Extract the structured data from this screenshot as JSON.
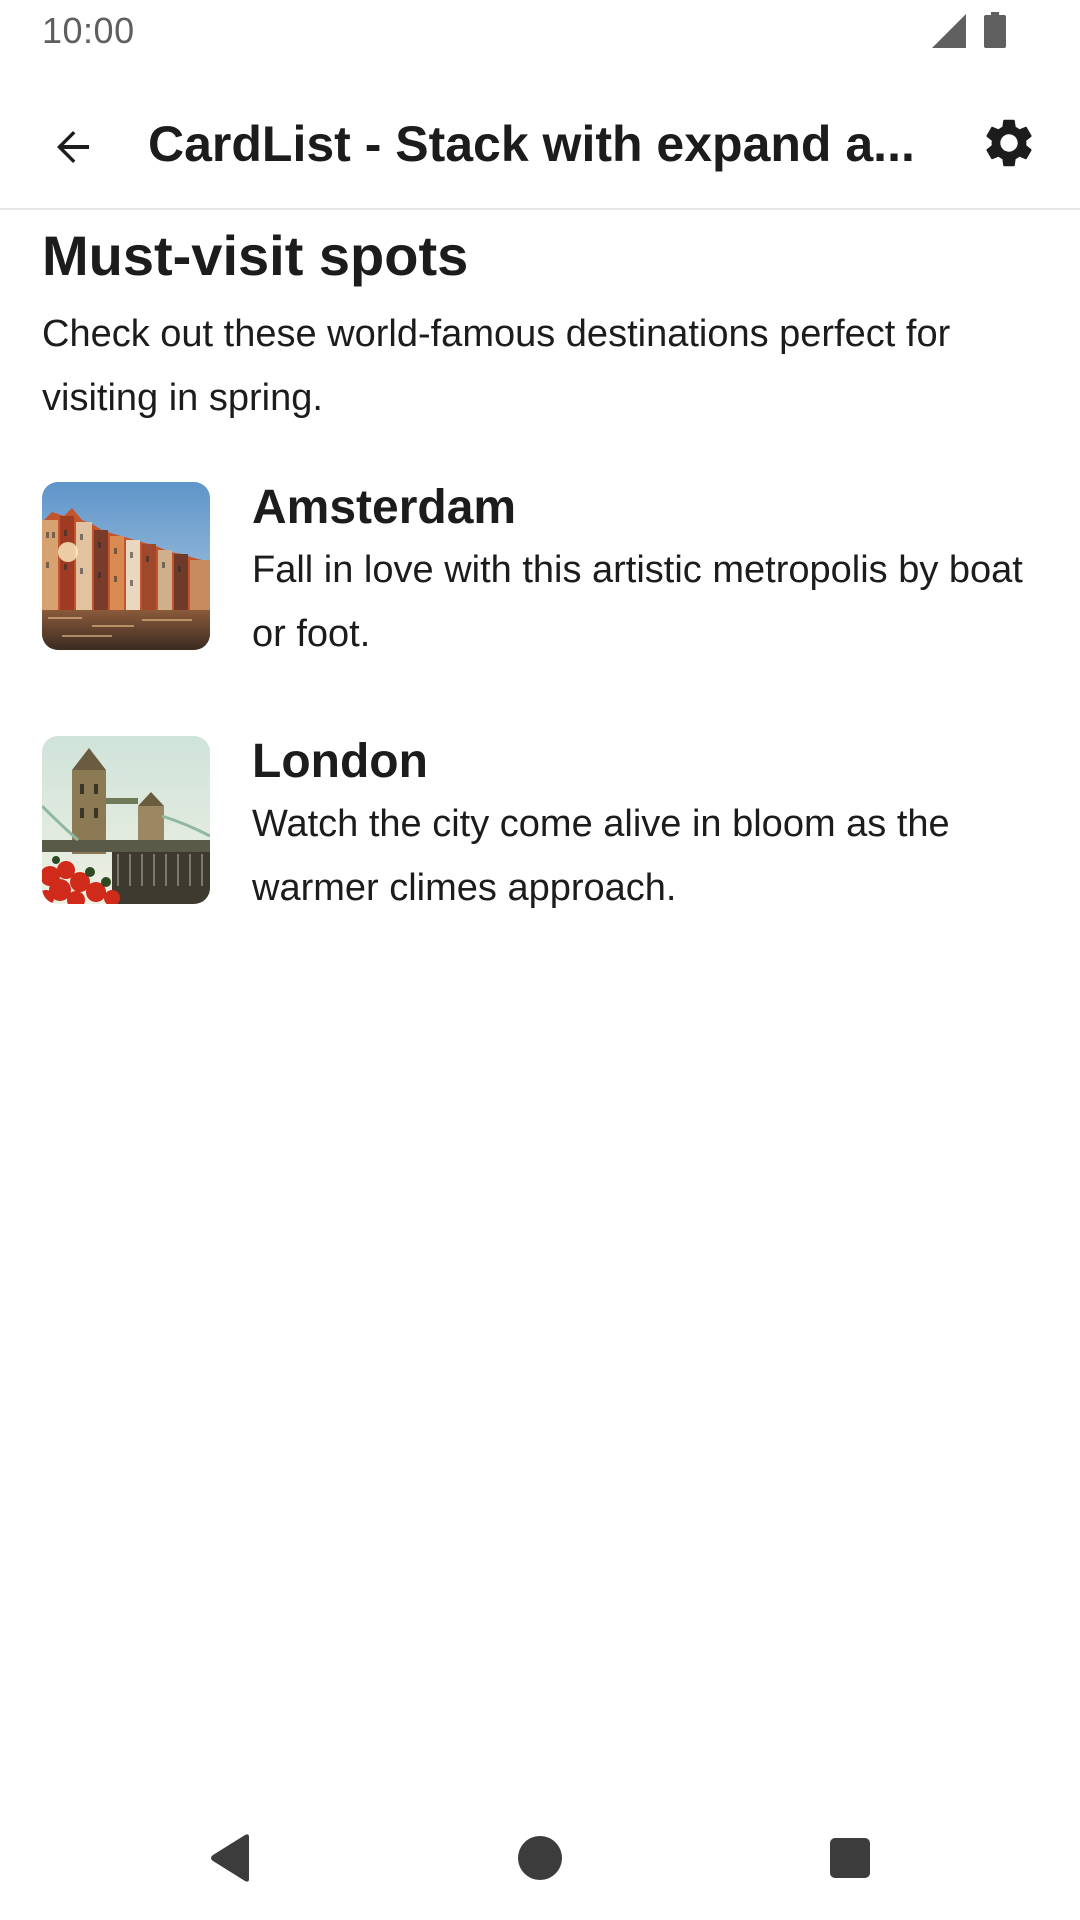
{
  "status_bar": {
    "time": "10:00"
  },
  "app_bar": {
    "title": "CardList - Stack with expand a..."
  },
  "section": {
    "title": "Must-visit spots",
    "description": "Check out these world-famous destinations perfect for visiting in spring."
  },
  "cards": [
    {
      "title": "Amsterdam",
      "description": "Fall in love with this artistic metropolis by boat or foot."
    },
    {
      "title": "London",
      "description": "Watch the city come alive in bloom as the warmer climes approach."
    }
  ],
  "icons": {
    "back": "arrow-back-icon",
    "settings": "gear-icon",
    "signal": "cell-signal-icon",
    "battery": "battery-icon",
    "nav_back": "triangle-back-icon",
    "nav_home": "circle-home-icon",
    "nav_recents": "square-recents-icon"
  },
  "colors": {
    "text": "#1c1c1c",
    "status_text": "#5f5f5f",
    "divider": "#e6e6e6",
    "nav_icons": "#3c3c3c"
  }
}
